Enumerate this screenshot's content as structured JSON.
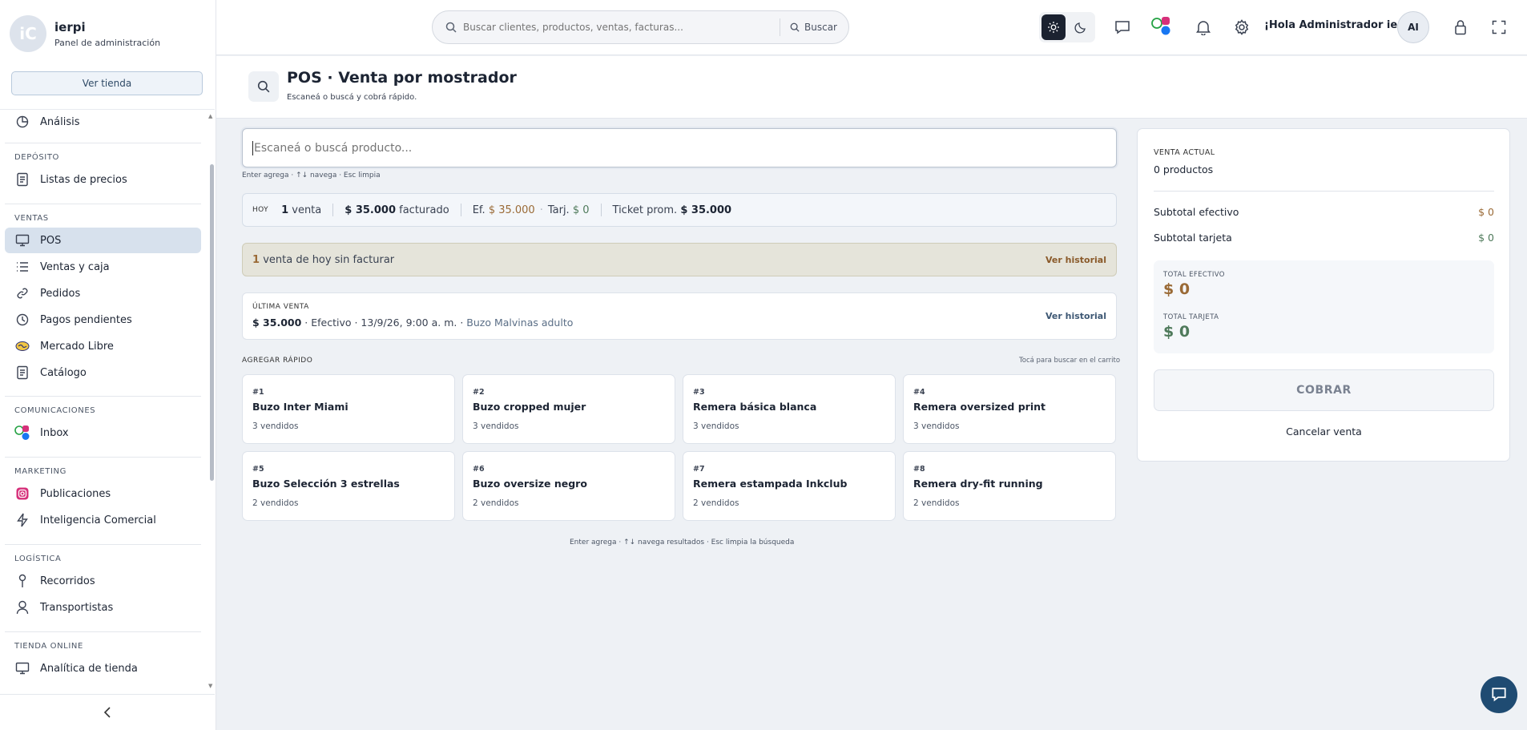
{
  "brand": {
    "logo_text": "iC",
    "name": "ierpi",
    "subtitle": "Panel de administración",
    "store_button": "Ver tienda"
  },
  "sidebar": {
    "top_item": "Análisis",
    "sections": {
      "deposito": "DEPÓSITO",
      "ventas": "VENTAS",
      "comunicaciones": "COMUNICACIONES",
      "marketing": "MARKETING",
      "logistica": "LOGÍSTICA",
      "tienda": "TIENDA ONLINE"
    },
    "items": {
      "listas": "Listas de precios",
      "pos": "POS",
      "ventas_caja": "Ventas y caja",
      "pedidos": "Pedidos",
      "pagos": "Pagos pendientes",
      "mercado": "Mercado Libre",
      "catalogo": "Catálogo",
      "inbox": "Inbox",
      "publicaciones": "Publicaciones",
      "inteligencia": "Inteligencia Comercial",
      "recorridos": "Recorridos",
      "transportistas": "Transportistas",
      "analitica": "Analítica de tienda"
    }
  },
  "topbar": {
    "search_placeholder": "Buscar clientes, productos, ventas, facturas...",
    "search_button": "Buscar",
    "greeting": "¡Hola Administrador ierpi!",
    "avatar": "AI"
  },
  "page": {
    "title": "POS · Venta por mostrador",
    "subtitle": "Escaneá o buscá y cobrá rápido."
  },
  "pos": {
    "search_placeholder": "Escaneá o buscá producto...",
    "search_hint": "Enter agrega · ↑↓ navega · Esc limpia",
    "today": {
      "label": "HOY",
      "sales_count": "1",
      "sales_word": "venta",
      "billed_amount": "$ 35.000",
      "billed_word": "facturado",
      "cash_label": "Ef.",
      "cash_amount": "$ 35.000",
      "card_label": "Tarj.",
      "card_amount": "$ 0",
      "avg_label": "Ticket prom.",
      "avg_amount": "$ 35.000"
    },
    "alert": {
      "count": "1",
      "text": "venta de hoy sin facturar",
      "link": "Ver historial"
    },
    "last_sale": {
      "label": "ÚLTIMA VENTA",
      "amount": "$ 35.000",
      "details": "· Efectivo · 13/9/26, 9:00 a. m. ·",
      "product": "Buzo Malvinas adulto",
      "link": "Ver historial"
    },
    "quick": {
      "title": "AGREGAR RÁPIDO",
      "hint": "Tocá para buscar en el carrito",
      "items": [
        {
          "num": "#1",
          "name": "Buzo Inter Miami",
          "sold": "3 vendidos"
        },
        {
          "num": "#2",
          "name": "Buzo cropped mujer",
          "sold": "3 vendidos"
        },
        {
          "num": "#3",
          "name": "Remera básica blanca",
          "sold": "3 vendidos"
        },
        {
          "num": "#4",
          "name": "Remera oversized print",
          "sold": "3 vendidos"
        },
        {
          "num": "#5",
          "name": "Buzo Selección 3 estrellas",
          "sold": "2 vendidos"
        },
        {
          "num": "#6",
          "name": "Buzo oversize negro",
          "sold": "2 vendidos"
        },
        {
          "num": "#7",
          "name": "Remera estampada Inkclub",
          "sold": "2 vendidos"
        },
        {
          "num": "#8",
          "name": "Remera dry-fit running",
          "sold": "2 vendidos"
        }
      ]
    },
    "footer_hint": "Enter agrega · ↑↓ navega resultados · Esc limpia la búsqueda"
  },
  "cart": {
    "label": "VENTA ACTUAL",
    "count": "0 productos",
    "subtotal_cash_label": "Subtotal efectivo",
    "subtotal_cash": "$ 0",
    "subtotal_card_label": "Subtotal tarjeta",
    "subtotal_card": "$ 0",
    "total_cash_label": "TOTAL EFECTIVO",
    "total_cash": "$ 0",
    "total_card_label": "TOTAL TARJETA",
    "total_card": "$ 0",
    "charge_button": "COBRAR",
    "cancel_button": "Cancelar venta"
  },
  "colors": {
    "accent": "#1f4b72",
    "cash": "#9a6a36",
    "card": "#4f7a5b",
    "active_nav": "#d7e1ed"
  }
}
